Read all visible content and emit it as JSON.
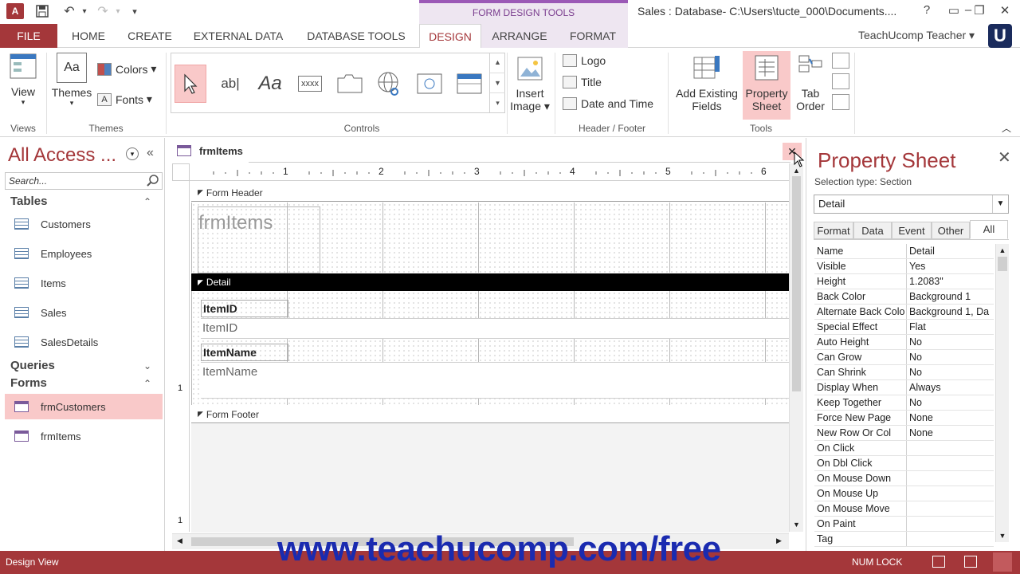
{
  "app": {
    "window_title": "Sales : Database- C:\\Users\\tucte_000\\Documents....",
    "context_tab_header": "FORM DESIGN TOOLS",
    "user_name": "TeachUcomp Teacher"
  },
  "qat": {
    "undo": "↶",
    "redo": "↷",
    "customize": "▾"
  },
  "tabs": [
    {
      "label": "FILE"
    },
    {
      "label": "HOME"
    },
    {
      "label": "CREATE"
    },
    {
      "label": "EXTERNAL DATA"
    },
    {
      "label": "DATABASE TOOLS"
    },
    {
      "label": "DESIGN"
    },
    {
      "label": "ARRANGE"
    },
    {
      "label": "FORMAT"
    }
  ],
  "ribbon": {
    "views": {
      "view_label": "View",
      "group": "Views"
    },
    "themes": {
      "themes_label": "Themes",
      "colors_label": "Colors",
      "fonts_label": "Fonts",
      "group": "Themes"
    },
    "controls": {
      "group": "Controls",
      "textbox": "ab|",
      "label_ctrl": "Aa",
      "button_ctrl": "xxxx"
    },
    "image": {
      "insert_image_1": "Insert",
      "insert_image_2": "Image"
    },
    "header_footer": {
      "logo": "Logo",
      "title": "Title",
      "date_time": "Date and Time",
      "group": "Header / Footer"
    },
    "tools": {
      "add_fields_1": "Add Existing",
      "add_fields_2": "Fields",
      "prop_sheet_1": "Property",
      "prop_sheet_2": "Sheet",
      "tab_order_1": "Tab",
      "tab_order_2": "Order",
      "group": "Tools"
    }
  },
  "nav": {
    "title": "All Access ...",
    "search_placeholder": "Search...",
    "tables_label": "Tables",
    "tables": [
      "Customers",
      "Employees",
      "Items",
      "Sales",
      "SalesDetails"
    ],
    "queries_label": "Queries",
    "forms_label": "Forms",
    "forms": [
      "frmCustomers",
      "frmItems"
    ]
  },
  "document": {
    "tab_label": "frmItems",
    "ruler_marks": [
      "1",
      "2",
      "3",
      "4",
      "5",
      "6"
    ],
    "form_header_label": "Form Header",
    "form_title": "frmItems",
    "detail_label": "Detail",
    "field1_label": "ItemID",
    "field1_text": "ItemID",
    "field2_label": "ItemName",
    "field2_text": "ItemName",
    "form_footer_label": "Form Footer",
    "vruler_mark": "1"
  },
  "property_sheet": {
    "title": "Property Sheet",
    "selection_type_label": "Selection type:  Section",
    "selected": "Detail",
    "tabs": [
      "Format",
      "Data",
      "Event",
      "Other",
      "All"
    ],
    "rows": [
      [
        "Name",
        "Detail"
      ],
      [
        "Visible",
        "Yes"
      ],
      [
        "Height",
        "1.2083\""
      ],
      [
        "Back Color",
        "Background 1"
      ],
      [
        "Alternate Back Colo",
        "Background 1, Da"
      ],
      [
        "Special Effect",
        "Flat"
      ],
      [
        "Auto Height",
        "No"
      ],
      [
        "Can Grow",
        "No"
      ],
      [
        "Can Shrink",
        "No"
      ],
      [
        "Display When",
        "Always"
      ],
      [
        "Keep Together",
        "No"
      ],
      [
        "Force New Page",
        "None"
      ],
      [
        "New Row Or Col",
        "None"
      ],
      [
        "On Click",
        ""
      ],
      [
        "On Dbl Click",
        ""
      ],
      [
        "On Mouse Down",
        ""
      ],
      [
        "On Mouse Up",
        ""
      ],
      [
        "On Mouse Move",
        ""
      ],
      [
        "On Paint",
        ""
      ],
      [
        "Tag",
        ""
      ]
    ]
  },
  "status": {
    "left": "Design View",
    "num_lock": "NUM LOCK"
  },
  "watermark": "www.teachucomp.com/free",
  "colors": {
    "accent": "#a4373a",
    "selected": "#f9c9c9",
    "context": "#9b59b6"
  }
}
